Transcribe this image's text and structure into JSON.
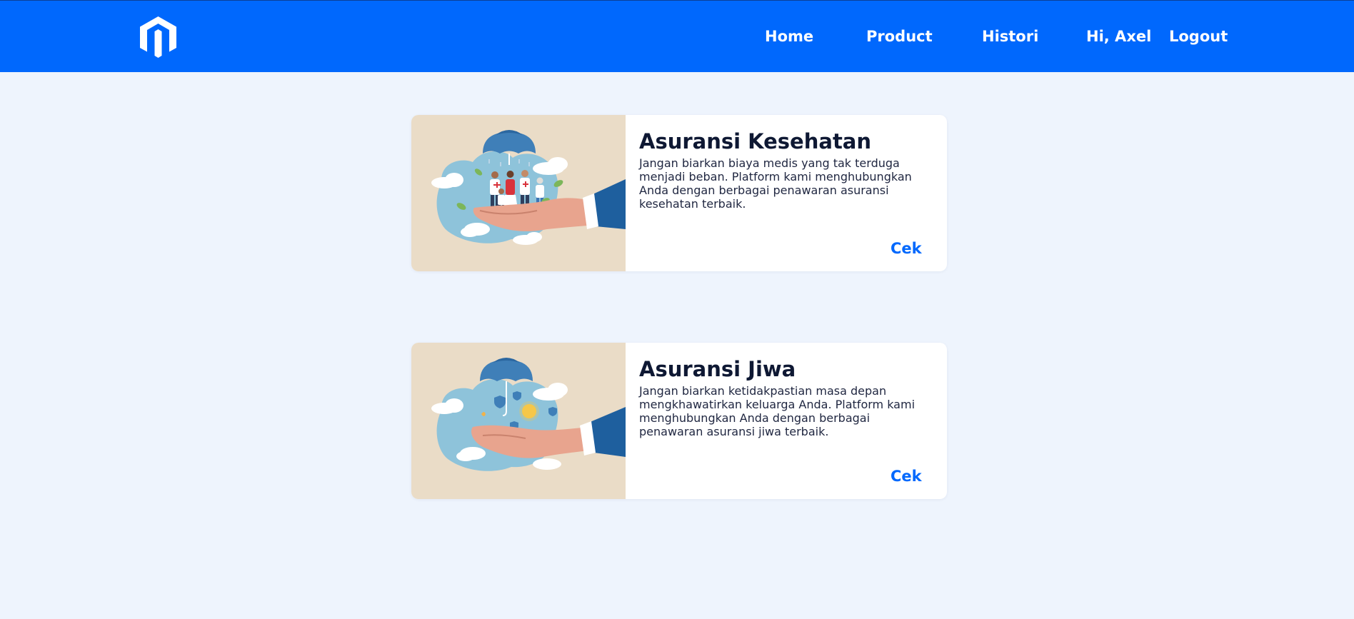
{
  "nav": {
    "logo": "brand-logo-icon",
    "links": [
      "Home",
      "Product",
      "Histori"
    ],
    "greeting": "Hi, Axel",
    "logout": "Logout"
  },
  "cards": [
    {
      "title": "Asuransi Kesehatan",
      "description": "Jangan biarkan biaya medis yang tak terduga menjadi beban. Platform kami menghubungkan Anda dengan berbagai penawaran asuransi kesehatan terbaik.",
      "action": "Cek",
      "image": "family-under-umbrella-illustration"
    },
    {
      "title": "Asuransi Jiwa",
      "description": "Jangan biarkan ketidakpastian masa depan mengkhawatirkan keluarga Anda. Platform kami menghubungkan Anda dengan berbagai penawaran asuransi jiwa terbaik.",
      "action": "Cek",
      "image": "hand-with-umbrella-illustration"
    }
  ],
  "colors": {
    "primary": "#0068fd",
    "background": "#eef4fd",
    "card": "#ffffff",
    "title": "#0e1833",
    "illustration_bg": "#eadcc7"
  }
}
